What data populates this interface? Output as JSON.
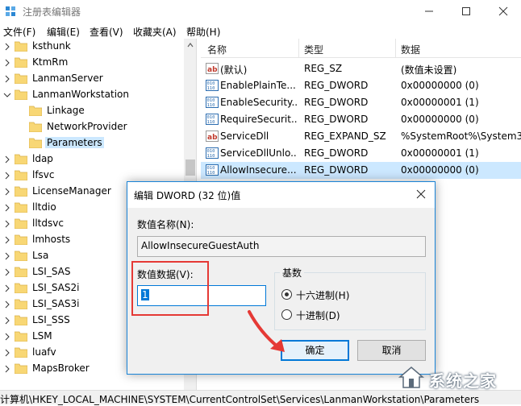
{
  "window": {
    "title": "注册表编辑器",
    "menus": [
      "文件(F)",
      "编辑(E)",
      "查看(V)",
      "收藏夹(A)",
      "帮助(H)"
    ]
  },
  "tree": {
    "items": [
      {
        "label": "ksthunk",
        "indent": 0,
        "arrow": "right"
      },
      {
        "label": "KtmRm",
        "indent": 0,
        "arrow": "right"
      },
      {
        "label": "LanmanServer",
        "indent": 0,
        "arrow": "right"
      },
      {
        "label": "LanmanWorkstation",
        "indent": 0,
        "arrow": "down"
      },
      {
        "label": "Linkage",
        "indent": 1,
        "arrow": ""
      },
      {
        "label": "NetworkProvider",
        "indent": 1,
        "arrow": ""
      },
      {
        "label": "Parameters",
        "indent": 1,
        "arrow": "",
        "selected": true
      },
      {
        "label": "ldap",
        "indent": 0,
        "arrow": "right"
      },
      {
        "label": "lfsvc",
        "indent": 0,
        "arrow": "right"
      },
      {
        "label": "LicenseManager",
        "indent": 0,
        "arrow": "right"
      },
      {
        "label": "lltdio",
        "indent": 0,
        "arrow": "right"
      },
      {
        "label": "lltdsvc",
        "indent": 0,
        "arrow": "right"
      },
      {
        "label": "lmhosts",
        "indent": 0,
        "arrow": "right"
      },
      {
        "label": "Lsa",
        "indent": 0,
        "arrow": "right"
      },
      {
        "label": "LSI_SAS",
        "indent": 0,
        "arrow": "right"
      },
      {
        "label": "LSI_SAS2i",
        "indent": 0,
        "arrow": "right"
      },
      {
        "label": "LSI_SAS3i",
        "indent": 0,
        "arrow": "right"
      },
      {
        "label": "LSI_SSS",
        "indent": 0,
        "arrow": "right"
      },
      {
        "label": "LSM",
        "indent": 0,
        "arrow": "right"
      },
      {
        "label": "luafv",
        "indent": 0,
        "arrow": "right"
      },
      {
        "label": "MapsBroker",
        "indent": 0,
        "arrow": "right"
      }
    ]
  },
  "list": {
    "headers": [
      "名称",
      "类型",
      "数据"
    ],
    "rows": [
      {
        "icon": "string",
        "name": "(默认)",
        "type": "REG_SZ",
        "data": "(数值未设置)"
      },
      {
        "icon": "binary",
        "name": "EnablePlainTe...",
        "type": "REG_DWORD",
        "data": "0x00000000 (0)"
      },
      {
        "icon": "binary",
        "name": "EnableSecurity...",
        "type": "REG_DWORD",
        "data": "0x00000001 (1)"
      },
      {
        "icon": "binary",
        "name": "RequireSecurit...",
        "type": "REG_DWORD",
        "data": "0x00000000 (0)"
      },
      {
        "icon": "string",
        "name": "ServiceDll",
        "type": "REG_EXPAND_SZ",
        "data": "%SystemRoot%\\System32"
      },
      {
        "icon": "binary",
        "name": "ServiceDllUnlo...",
        "type": "REG_DWORD",
        "data": "0x00000001 (1)"
      },
      {
        "icon": "binary",
        "name": "AllowInsecure...",
        "type": "REG_DWORD",
        "data": "0x00000000 (0)",
        "selected": true
      }
    ]
  },
  "statusbar": {
    "path": "计算机\\HKEY_LOCAL_MACHINE\\SYSTEM\\CurrentControlSet\\Services\\LanmanWorkstation\\Parameters"
  },
  "dialog": {
    "title": "编辑 DWORD (32 位)值",
    "value_name_label": "数值名称(N):",
    "value_name": "AllowInsecureGuestAuth",
    "value_data_label": "数值数据(V):",
    "value_data": "1",
    "base_label": "基数",
    "radix_options": [
      {
        "label": "十六进制(H)",
        "checked": true
      },
      {
        "label": "十进制(D)",
        "checked": false
      }
    ],
    "ok_label": "确定",
    "cancel_label": "取消"
  },
  "watermark": {
    "text": "系统之家"
  },
  "colors": {
    "selection": "#cce8ff",
    "dialog_border": "#1883d7",
    "annotation_red": "#e53935",
    "folder_yellow": "#f8d775"
  }
}
